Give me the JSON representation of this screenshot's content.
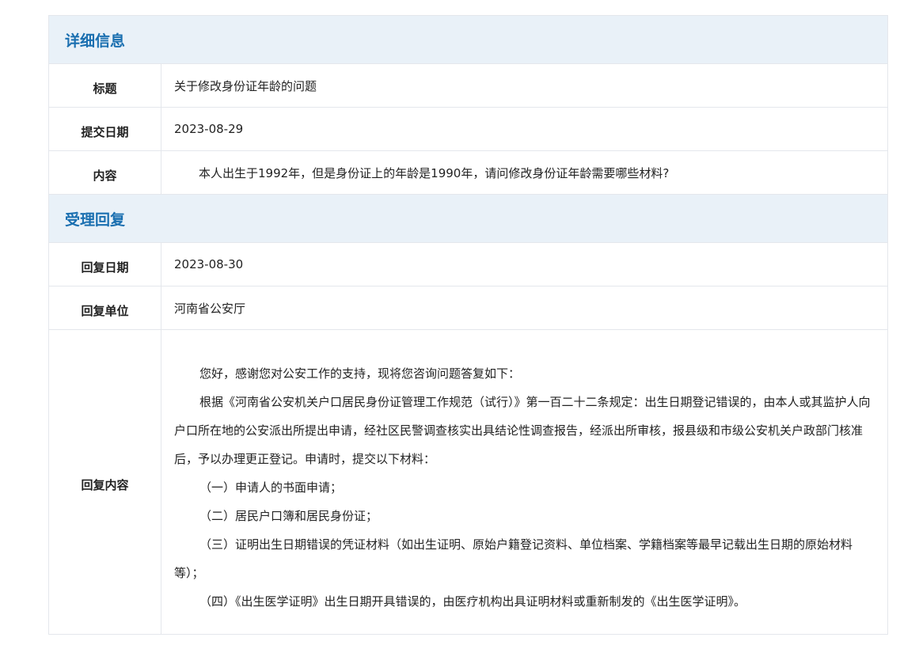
{
  "sections": {
    "detail_title": "详细信息",
    "reply_title": "受理回复"
  },
  "detail": {
    "title_label": "标题",
    "title_value": "关于修改身份证年龄的问题",
    "date_label": "提交日期",
    "date_value": "2023-08-29",
    "content_label": "内容",
    "content_value": "本人出生于1992年，但是身份证上的年龄是1990年，请问修改身份证年龄需要哪些材料?"
  },
  "reply": {
    "date_label": "回复日期",
    "date_value": "2023-08-30",
    "unit_label": "回复单位",
    "unit_value": "河南省公安厅",
    "content_label": "回复内容",
    "paragraphs": [
      "您好，感谢您对公安工作的支持，现将您咨询问题答复如下：",
      "根据《河南省公安机关户口居民身份证管理工作规范（试行）》第一百二十二条规定：出生日期登记错误的，由本人或其监护人向户口所在地的公安派出所提出申请，经社区民警调查核实出具结论性调查报告，经派出所审核，报县级和市级公安机关户政部门核准后，予以办理更正登记。申请时，提交以下材料：",
      "（一）申请人的书面申请；",
      "（二）居民户口簿和居民身份证；",
      "（三）证明出生日期错误的凭证材料（如出生证明、原始户籍登记资料、单位档案、学籍档案等最早记载出生日期的原始材料等）；",
      "（四）《出生医学证明》出生日期开具错误的，由医疗机构出具证明材料或重新制发的《出生医学证明》。"
    ]
  }
}
